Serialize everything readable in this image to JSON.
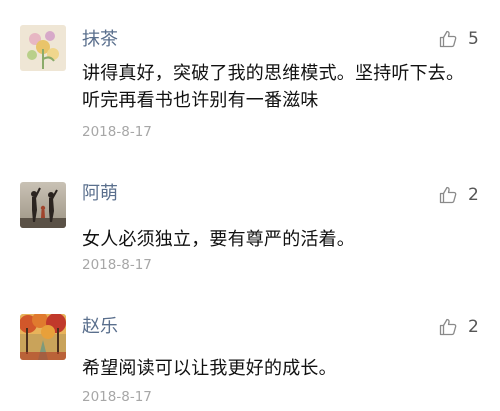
{
  "comments": [
    {
      "name": "抹茶",
      "avatar_icon": "flower-avatar-icon",
      "like_icon": "thumbs-up-icon",
      "likes": "5",
      "text": "讲得真好，突破了我的思维模式。坚持听下去。听完再看书也许别有一番滋味",
      "date": "2018-8-17"
    },
    {
      "name": "阿萌",
      "avatar_icon": "silhouette-people-avatar-icon",
      "like_icon": "thumbs-up-icon",
      "likes": "2",
      "text": "女人必须独立，要有尊严的活着。",
      "date": "2018-8-17"
    },
    {
      "name": "赵乐",
      "avatar_icon": "autumn-trees-avatar-icon",
      "like_icon": "thumbs-up-icon",
      "likes": "2",
      "text": "希望阅读可以让我更好的成长。",
      "date": "2018-8-17"
    }
  ],
  "colors": {
    "name": "#5a6f8d",
    "text": "#111111",
    "date": "#a7a7a7",
    "like_icon": "#8a8a8a"
  }
}
